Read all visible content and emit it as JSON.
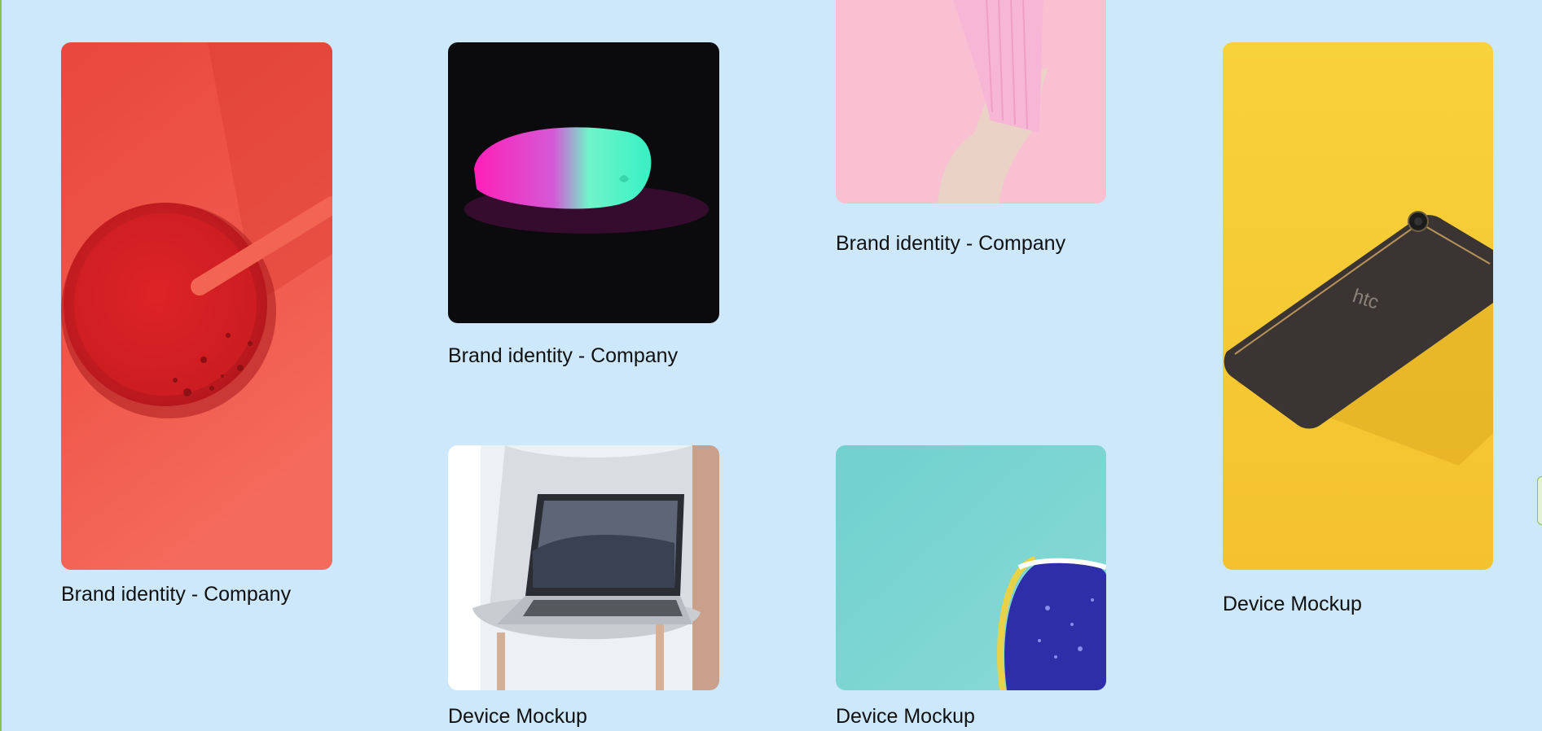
{
  "gallery": {
    "items": [
      {
        "caption": "Brand identity - Company",
        "image": "red-drink-cup-image"
      },
      {
        "caption": "Brand identity - Company",
        "image": "neon-mouse-image"
      },
      {
        "caption": "Brand identity - Company",
        "image": "pink-sock-image"
      },
      {
        "caption": "Device Mockup",
        "image": "htc-phone-image"
      },
      {
        "caption": "Device Mockup",
        "image": "laptop-on-chair-image"
      },
      {
        "caption": "Device Mockup",
        "image": "sneaker-teal-image"
      }
    ]
  },
  "colors": {
    "background": "#cde7fb",
    "accent": "#8bc34a"
  }
}
